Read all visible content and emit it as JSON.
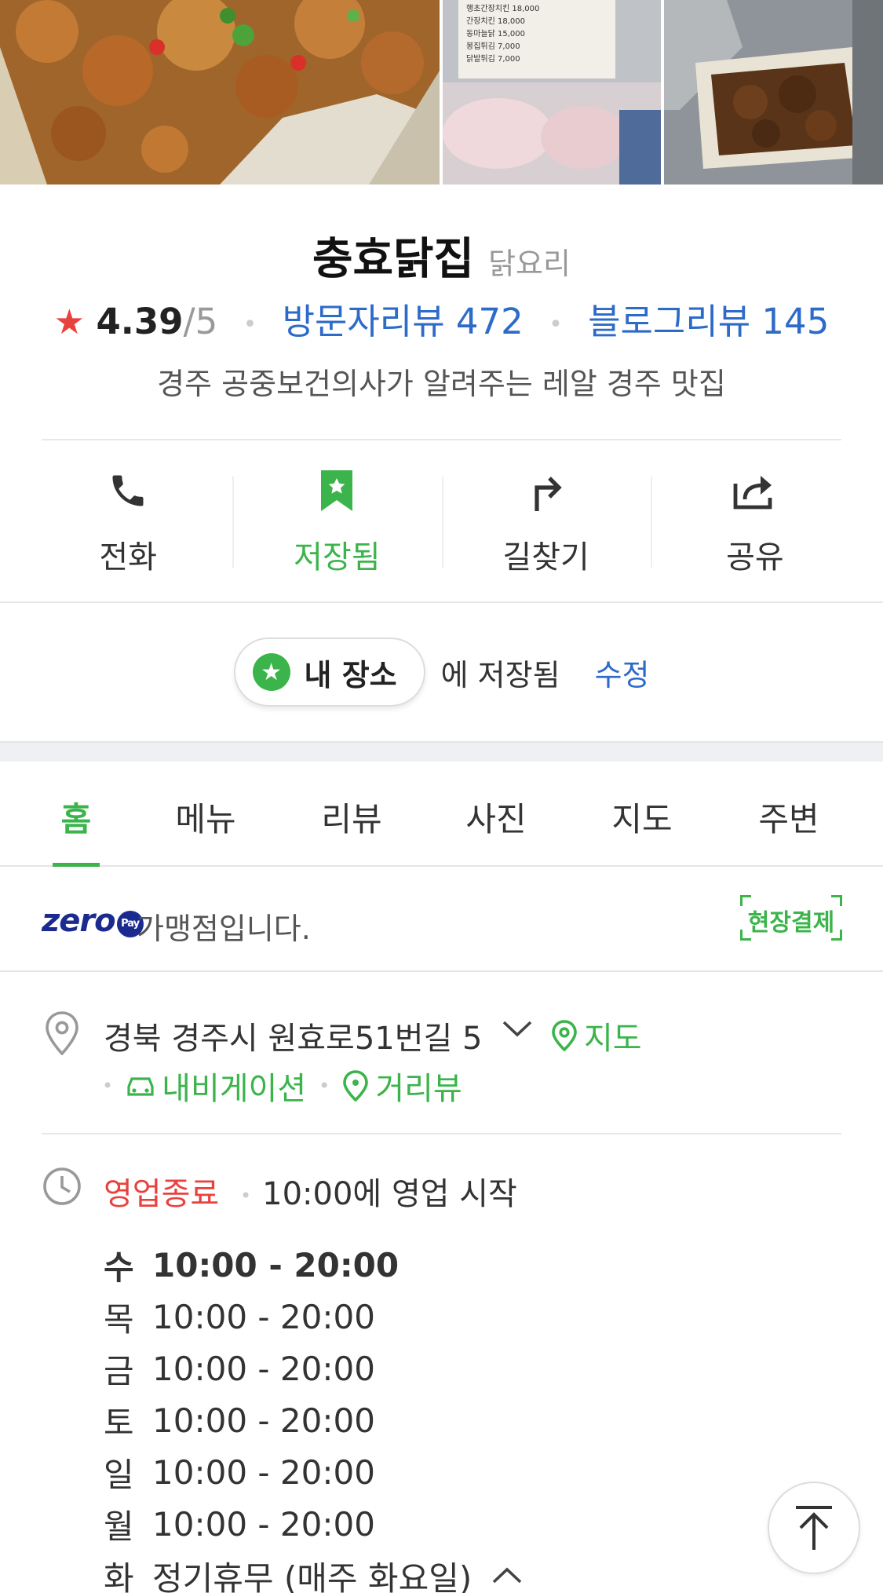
{
  "place": {
    "name": "충효닭집",
    "category": "닭요리",
    "rating": "4.39",
    "rating_max": "/5",
    "visitor_reviews": "방문자리뷰 472",
    "blog_reviews": "블로그리뷰 145",
    "description": "경주 공중보건의사가 알려주는 레알 경주 맛집"
  },
  "photos": {
    "menu_lines": [
      "행초간장치킨 18,000",
      "간장치킨 18,000",
      "동마늘닭 15,000",
      "봉집튀김 7,000",
      "닭발튀김 7,000"
    ]
  },
  "actions": [
    {
      "label": "전화",
      "icon": "phone-icon"
    },
    {
      "label": "저장됨",
      "icon": "bookmark-icon"
    },
    {
      "label": "길찾기",
      "icon": "directions-icon"
    },
    {
      "label": "공유",
      "icon": "share-icon"
    }
  ],
  "saved": {
    "chip_label": "내 장소",
    "saved_text": "에 저장됨",
    "edit_label": "수정"
  },
  "tabs": [
    "홈",
    "메뉴",
    "리뷰",
    "사진",
    "지도",
    "주변"
  ],
  "zero_pay": {
    "logo": "zero",
    "pay_badge": "Pay",
    "text": "가맹점입니다.",
    "onsite_label": "현장결제"
  },
  "address": {
    "text": "경북 경주시 원효로51번길 5",
    "map_label": "지도",
    "navigation_label": "내비게이션",
    "street_view_label": "거리뷰"
  },
  "hours": {
    "status": "영업종료",
    "next_open": "10:00에 영업 시작",
    "schedule": [
      {
        "day": "수",
        "time": "10:00 - 20:00"
      },
      {
        "day": "목",
        "time": "10:00 - 20:00"
      },
      {
        "day": "금",
        "time": "10:00 - 20:00"
      },
      {
        "day": "토",
        "time": "10:00 - 20:00"
      },
      {
        "day": "일",
        "time": "10:00 - 20:00"
      },
      {
        "day": "월",
        "time": "10:00 - 20:00"
      },
      {
        "day": "화",
        "time": "정기휴무 (매주 화요일)"
      }
    ]
  },
  "colors": {
    "green": "#3bb44b",
    "blue": "#2d6bc8",
    "red": "#e8423f"
  }
}
